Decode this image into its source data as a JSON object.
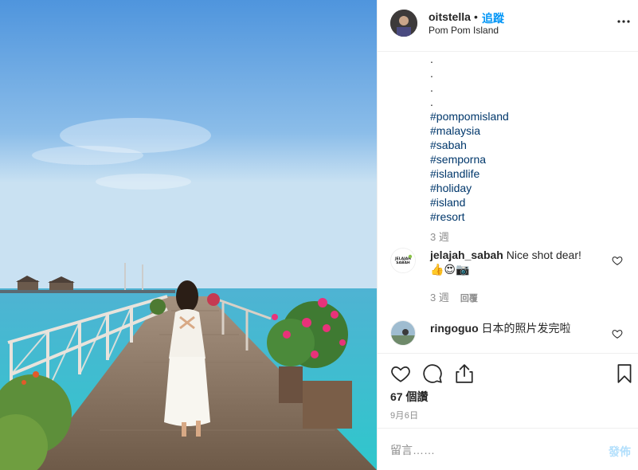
{
  "post": {
    "username": "oitstella",
    "separator": "•",
    "follow_label": "追蹤",
    "location": "Pom Pom Island"
  },
  "caption": {
    "dots": [
      ".",
      ".",
      ".",
      "."
    ],
    "hashtags": [
      "#pompomisland",
      "#malaysia",
      "#sabah",
      "#semporna",
      "#islandlife",
      "#holiday",
      "#island",
      "#resort"
    ],
    "age": "3 週"
  },
  "comments": [
    {
      "username": "jelajah_sabah",
      "text": "Nice shot dear!",
      "emoji": "👍😍📷",
      "age": "3 週",
      "reply_label": "回覆",
      "avatar_text": "JELAJAH SABAH"
    },
    {
      "username": "ringoguo",
      "text": "日本的照片发完啦"
    }
  ],
  "stats": {
    "likes": "67 個讚",
    "date": "9月6日"
  },
  "composer": {
    "placeholder": "留言……",
    "post_label": "發佈"
  },
  "colors": {
    "link": "#00376b",
    "follow": "#0095f6",
    "muted": "#8e8e8e",
    "post_disabled": "#b2dffc"
  }
}
